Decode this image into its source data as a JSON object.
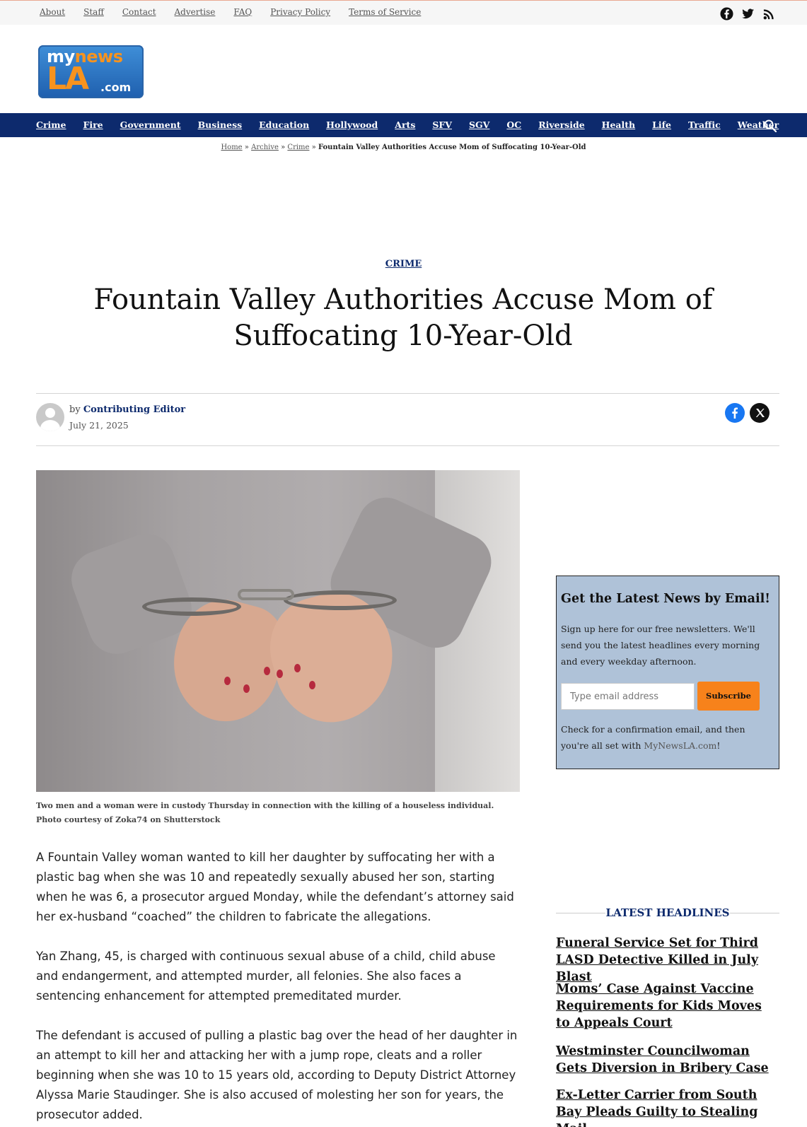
{
  "top_links": [
    "About",
    "Staff",
    "Contact",
    "Advertise",
    "FAQ",
    "Privacy Policy",
    "Terms of Service"
  ],
  "social_icons": [
    "facebook-icon",
    "twitter-icon",
    "rss-icon"
  ],
  "logo": {
    "line1_a": "my",
    "line1_b": "news",
    "line2": "LA",
    "line3": ".com"
  },
  "nav": [
    "Crime",
    "Fire",
    "Government",
    "Business",
    "Education",
    "Hollywood",
    "Arts",
    "SFV",
    "SGV",
    "OC",
    "Riverside",
    "Health",
    "Life",
    "Traffic",
    "Weather"
  ],
  "breadcrumb": {
    "home": "Home",
    "archive": "Archive",
    "crime": "Crime",
    "sep": "»",
    "current": "Fountain Valley Authorities Accuse Mom of Suffocating 10-Year-Old"
  },
  "category": "CRIME",
  "title": "Fountain Valley Authorities Accuse Mom of Suffocating 10-Year-Old",
  "byline": {
    "by": "by",
    "author": "Contributing Editor",
    "date": "July 21, 2025"
  },
  "caption": "Two men and a woman were in custody Thursday in connection with the killing of a houseless individual. Photo courtesy of Zoka74 on Shutterstock",
  "article": [
    "A Fountain Valley woman wanted to kill her daughter by suffocating her with a plastic bag when she was 10 and repeatedly sexually abused her son, starting when he was 6, a prosecutor argued Monday, while the defendant’s attorney said her ex-husband “coached” the children to fabricate the allegations.",
    "Yan Zhang, 45, is charged with continuous sexual abuse of a child, child abuse and endangerment, and attempted murder, all felonies. She also faces a sentencing enhancement for attempted premeditated murder.",
    "The defendant is accused of pulling a plastic bag over the head of her daughter in an attempt to kill her and attacking her with a jump rope, cleats and a roller beginning when she was 10 to 15 years old, according to Deputy District Attorney Alyssa Marie Staudinger. She is also accused of molesting her son for years, the prosecutor added."
  ],
  "newsletter": {
    "heading": "Get the Latest News by Email!",
    "desc": "Sign up here for our free newsletters. We'll send you the latest headlines every morning and every weekday afternoon.",
    "placeholder": "Type email address",
    "button": "Subscribe",
    "confirm_a": "Check for a confirmation email, and then you're all set with ",
    "confirm_link": "MyNewsLA.com",
    "confirm_b": "!"
  },
  "latest": {
    "heading": "LATEST HEADLINES",
    "items": [
      "Funeral Service Set for Third LASD Detective Killed in July Blast",
      "Moms’ Case Against Vaccine Requirements for Kids Moves to Appeals Court",
      "Westminster Councilwoman Gets Diversion in Bribery Case",
      "Ex-Letter Carrier from South Bay Pleads Guilty to Stealing Mail"
    ]
  },
  "colors": {
    "nav_bg": "#0d2a6d",
    "accent": "#f7821b",
    "newsletter_bg": "#afc2d8"
  }
}
